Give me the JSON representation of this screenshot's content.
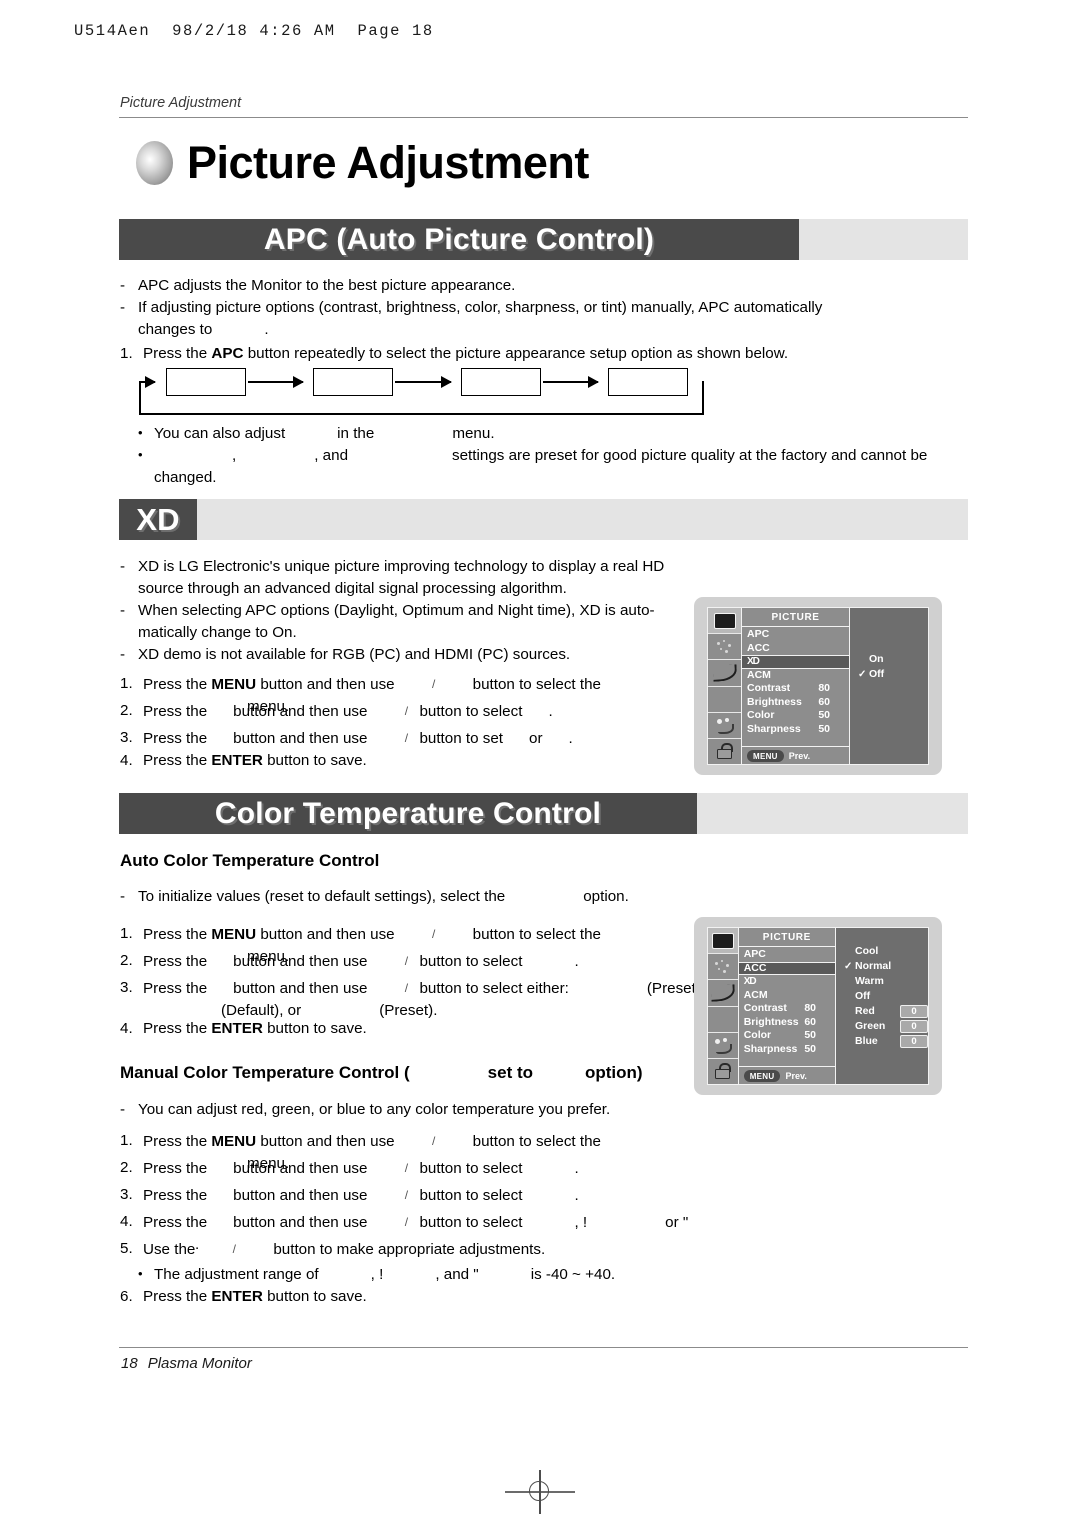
{
  "print_header": "U514Aen  98/2/18 4:26 AM  Page 18",
  "running_head": "Picture Adjustment",
  "chapter_title": "Picture Adjustment",
  "sections": {
    "apc": {
      "banner": "APC (Auto Picture Control)",
      "dash1": "APC adjusts the Monitor to the best picture appearance.",
      "dash2_a": "If adjusting picture options (contrast, brightness, color, sharpness, or tint) manually, APC automatically",
      "dash2_b": "changes to",
      "dash2_c": ".",
      "step1_a": "Press the",
      "step1_b": "APC",
      "step1_c": "button repeatedly to select the picture appearance setup option as shown below.",
      "bullet1_a": "You can also adjust",
      "bullet1_b": "in the",
      "bullet1_c": "menu.",
      "bullet2_a": ",",
      "bullet2_b": ", and",
      "bullet2_c": "settings are preset for good picture quality at the factory and cannot be",
      "bullet2_d": "changed."
    },
    "xd": {
      "banner": "XD",
      "dash1_a": "XD is LG Electronic's unique picture improving technology to display a real HD",
      "dash1_b": "source through an advanced digital signal processing algorithm.",
      "dash2_a": "When selecting APC options (Daylight, Optimum and Night time), XD is auto-",
      "dash2_b": "matically change to On.",
      "dash3": "XD demo is not available for RGB (PC) and HDMI (PC) sources.",
      "step1_a": "Press the",
      "step1_menu": "MENU",
      "step1_b": "button and then use",
      "step1_c": "button to select the",
      "step1_d": "menu.",
      "step2_a": "Press the",
      "step2_b": "button and then use",
      "step2_c": "button to select",
      "step2_d": ".",
      "step3_a": "Press the",
      "step3_b": "button and then use",
      "step3_c": "button to set",
      "step3_d": "or",
      "step3_e": ".",
      "step4_a": "Press the",
      "step4_enter": "ENTER",
      "step4_b": "button to save."
    },
    "color_temp": {
      "banner": "Color Temperature Control",
      "auto_subhead": "Auto Color Temperature Control",
      "auto_dash_a": "To initialize values (reset to default settings), select the",
      "auto_dash_b": "option.",
      "auto_step1_a": "Press the",
      "auto_step1_menu": "MENU",
      "auto_step1_b": "button and then use",
      "auto_step1_c": "button to select the",
      "auto_step1_d": "menu.",
      "auto_step2_a": "Press the",
      "auto_step2_b": "button and then use",
      "auto_step2_c": "button to select",
      "auto_step2_d": ".",
      "auto_step3_a": "Press the",
      "auto_step3_b": "button and then use",
      "auto_step3_c": "button to select either:",
      "auto_step3_d": "(Preset),",
      "auto_step3_e": "(Default), or",
      "auto_step3_f": "(Preset).",
      "auto_step4_a": "Press the",
      "auto_step4_enter": "ENTER",
      "auto_step4_b": "button to save.",
      "manual_subhead_a": "Manual Color Temperature Control (",
      "manual_subhead_b": "set to",
      "manual_subhead_c": "option)",
      "manual_dash": "You can adjust red, green, or blue to any color temperature you prefer.",
      "manual_step1_a": "Press the",
      "manual_step1_menu": "MENU",
      "manual_step1_b": "button and then use",
      "manual_step1_c": "button to select the",
      "manual_step1_d": "menu.",
      "manual_step2_a": "Press the",
      "manual_step2_b": "button and then use",
      "manual_step2_c": "button to select",
      "manual_step2_d": ".",
      "manual_step3_a": "Press the",
      "manual_step3_b": "button and then use",
      "manual_step3_c": "button to select",
      "manual_step3_d": ".",
      "manual_step4_a": "Press the",
      "manual_step4_b": "button and then use",
      "manual_step4_c": "button to select",
      "manual_step4_d": ", !",
      "manual_step4_e": "or \"",
      "manual_step4_f": ".",
      "manual_step5_a": "Use the",
      "manual_step5_b": "button to make appropriate adjustments.",
      "manual_bullet_a": "The adjustment range of",
      "manual_bullet_b": ", !",
      "manual_bullet_c": ", and \"",
      "manual_bullet_d": "is -40 ~ +40.",
      "manual_step6_a": "Press the",
      "manual_step6_enter": "ENTER",
      "manual_step6_b": "button to save."
    }
  },
  "osd_xd": {
    "title": "PICTURE",
    "rows": [
      {
        "label": "APC",
        "value": ""
      },
      {
        "label": "ACC",
        "value": ""
      },
      {
        "label": "XD",
        "value": ""
      },
      {
        "label": "ACM",
        "value": ""
      },
      {
        "label": "Contrast",
        "value": "80"
      },
      {
        "label": "Brightness",
        "value": "60"
      },
      {
        "label": "Color",
        "value": "50"
      },
      {
        "label": "Sharpness",
        "value": "50"
      }
    ],
    "selected_row": "XD",
    "menu_button": "MENU",
    "prev_label": "Prev.",
    "options": [
      {
        "label": "On",
        "checked": ""
      },
      {
        "label": "Off",
        "checked": "✓"
      }
    ]
  },
  "osd_color_temp": {
    "title": "PICTURE",
    "rows": [
      {
        "label": "APC",
        "value": ""
      },
      {
        "label": "ACC",
        "value": ""
      },
      {
        "label": "XD",
        "value": ""
      },
      {
        "label": "ACM",
        "value": ""
      },
      {
        "label": "Contrast",
        "value": "80"
      },
      {
        "label": "Brightness",
        "value": "60"
      },
      {
        "label": "Color",
        "value": "50"
      },
      {
        "label": "Sharpness",
        "value": "50"
      }
    ],
    "selected_row": "ACC",
    "menu_button": "MENU",
    "prev_label": "Prev.",
    "options": [
      {
        "label": "Cool",
        "checked": "",
        "value": ""
      },
      {
        "label": "Normal",
        "checked": "✓",
        "value": ""
      },
      {
        "label": "Warm",
        "checked": "",
        "value": ""
      },
      {
        "label": "Off",
        "checked": "",
        "value": ""
      },
      {
        "label": "Red",
        "checked": "",
        "value": "0"
      },
      {
        "label": "Green",
        "checked": "",
        "value": "0"
      },
      {
        "label": "Blue",
        "checked": "",
        "value": "0"
      }
    ]
  },
  "footer": {
    "page_number": "18",
    "product": "Plasma Monitor"
  },
  "colors": {
    "banner_dark": "#4a4a4a",
    "banner_light": "#e4e4e4",
    "osd_bg": "#6e6e6e",
    "osd_list": "#8d8d8d",
    "osd_selected": "#5a5a5a"
  }
}
